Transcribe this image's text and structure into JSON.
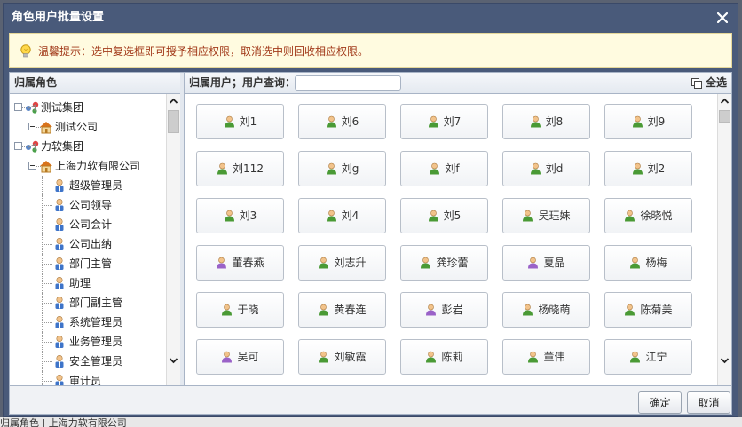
{
  "dialog": {
    "title": "角色用户批量设置"
  },
  "tip": {
    "text": "温馨提示：选中复选框即可授予相应权限，取消选中则回收相应权限。"
  },
  "left_panel": {
    "header": "归属角色"
  },
  "tree": [
    {
      "label": "测试集团",
      "icon": "group-icon"
    },
    {
      "label": "测试公司",
      "icon": "company-icon"
    },
    {
      "label": "力软集团",
      "icon": "group-icon"
    },
    {
      "label": "上海力软有限公司",
      "icon": "company-icon"
    },
    {
      "label": "超级管理员",
      "icon": "role-icon"
    },
    {
      "label": "公司领导",
      "icon": "role-icon"
    },
    {
      "label": "公司会计",
      "icon": "role-icon"
    },
    {
      "label": "公司出纳",
      "icon": "role-icon"
    },
    {
      "label": "部门主管",
      "icon": "role-icon"
    },
    {
      "label": "助理",
      "icon": "role-icon"
    },
    {
      "label": "部门副主管",
      "icon": "role-icon"
    },
    {
      "label": "系统管理员",
      "icon": "role-icon"
    },
    {
      "label": "业务管理员",
      "icon": "role-icon"
    },
    {
      "label": "安全管理员",
      "icon": "role-icon"
    },
    {
      "label": "审计员",
      "icon": "role-icon"
    }
  ],
  "right_panel": {
    "header": "归属用户；用户查询：",
    "search_value": "",
    "select_all_label": "全选"
  },
  "users": [
    {
      "name": "刘1",
      "gender": "male"
    },
    {
      "name": "刘6",
      "gender": "male"
    },
    {
      "name": "刘7",
      "gender": "male"
    },
    {
      "name": "刘8",
      "gender": "male"
    },
    {
      "name": "刘9",
      "gender": "male"
    },
    {
      "name": "刘112",
      "gender": "male"
    },
    {
      "name": "刘g",
      "gender": "male"
    },
    {
      "name": "刘f",
      "gender": "male"
    },
    {
      "name": "刘d",
      "gender": "male"
    },
    {
      "name": "刘2",
      "gender": "male"
    },
    {
      "name": "刘3",
      "gender": "male"
    },
    {
      "name": "刘4",
      "gender": "male"
    },
    {
      "name": "刘5",
      "gender": "male"
    },
    {
      "name": "吴珏妹",
      "gender": "male"
    },
    {
      "name": "徐晓悦",
      "gender": "male"
    },
    {
      "name": "董春燕",
      "gender": "female"
    },
    {
      "name": "刘志升",
      "gender": "male"
    },
    {
      "name": "龚珍蕾",
      "gender": "male"
    },
    {
      "name": "夏晶",
      "gender": "female"
    },
    {
      "name": "杨梅",
      "gender": "male"
    },
    {
      "name": "于晓",
      "gender": "male"
    },
    {
      "name": "黄春连",
      "gender": "male"
    },
    {
      "name": "彭岩",
      "gender": "female"
    },
    {
      "name": "杨晓萌",
      "gender": "male"
    },
    {
      "name": "陈菊美",
      "gender": "male"
    },
    {
      "name": "吴可",
      "gender": "female"
    },
    {
      "name": "刘敏霞",
      "gender": "male"
    },
    {
      "name": "陈莉",
      "gender": "male"
    },
    {
      "name": "董伟",
      "gender": "male"
    },
    {
      "name": "江宁",
      "gender": "male"
    }
  ],
  "footer": {
    "ok_label": "确定",
    "cancel_label": "取消"
  },
  "background": {
    "text": "归属角色  |  上海力软有限公司"
  },
  "colors": {
    "titlebar": "#495a7a",
    "tip_text": "#a23a1a",
    "tip_bg": "#fffbe0",
    "male_icon": "#4a9a35",
    "female_icon": "#9a62c8"
  }
}
